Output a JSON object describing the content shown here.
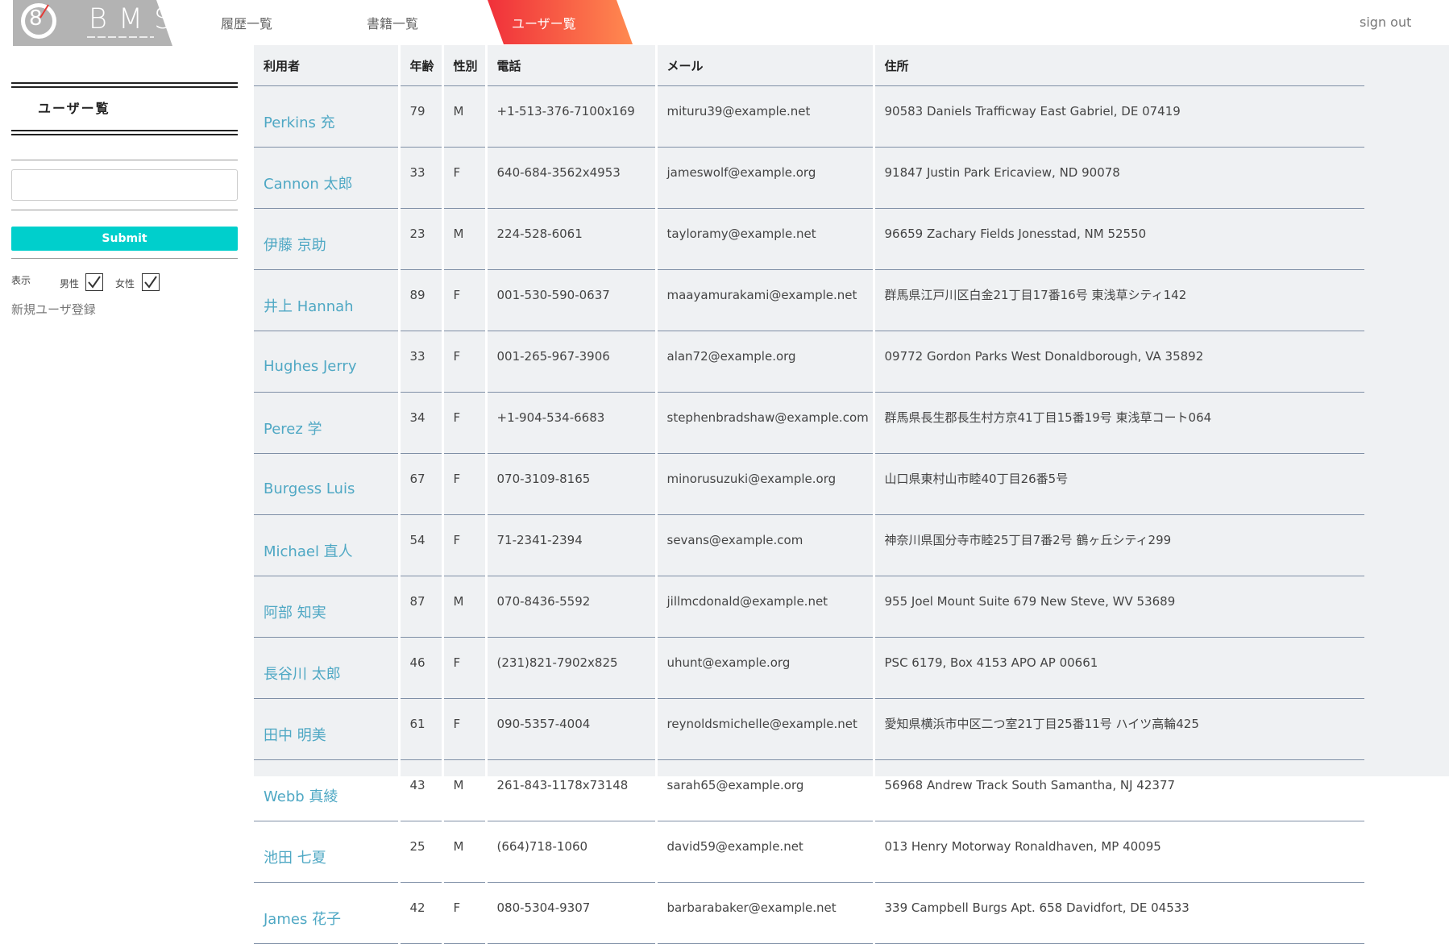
{
  "logo": {
    "text": "BMS",
    "digit": "8"
  },
  "nav": {
    "history": "履歴一覧",
    "books": "書籍一覧",
    "users": "ユーザー覧",
    "signout": "sign out"
  },
  "sidebar": {
    "title": "ユーザー覧",
    "search_value": "",
    "submit_label": "Submit",
    "display_label": "表示",
    "male_label": "男性",
    "female_label": "女性",
    "male_checked": true,
    "female_checked": true,
    "register_link": "新規ユーザ登録"
  },
  "colors": {
    "accent": "#00cfcc",
    "link": "#4fa8c4",
    "nav_active_start": "#f0303a",
    "nav_active_end": "#ff8a50",
    "panel_bg": "#eff1f3"
  },
  "table": {
    "headers": [
      "利用者",
      "年齢",
      "性別",
      "電話",
      "メール",
      "住所"
    ],
    "rows": [
      [
        "Perkins 充",
        "79",
        "M",
        "+1-513-376-7100x169",
        "mituru39@example.net",
        "90583 Daniels Trafficway East Gabriel, DE 07419"
      ],
      [
        "Cannon 太郎",
        "33",
        "F",
        "640-684-3562x4953",
        "jameswolf@example.org",
        "91847 Justin Park Ericaview, ND 90078"
      ],
      [
        "伊藤 京助",
        "23",
        "M",
        "224-528-6061",
        "tayloramy@example.net",
        "96659 Zachary Fields Jonesstad, NM 52550"
      ],
      [
        "井上 Hannah",
        "89",
        "F",
        "001-530-590-0637",
        "maayamurakami@example.net",
        "群馬県江戸川区白金21丁目17番16号 東浅草シティ142"
      ],
      [
        "Hughes Jerry",
        "33",
        "F",
        "001-265-967-3906",
        "alan72@example.org",
        "09772 Gordon Parks West Donaldborough, VA 35892"
      ],
      [
        "Perez 学",
        "34",
        "F",
        "+1-904-534-6683",
        "stephenbradshaw@example.com",
        "群馬県長生郡長生村方京41丁目15番19号 東浅草コート064"
      ],
      [
        "Burgess Luis",
        "67",
        "F",
        "070-3109-8165",
        "minorusuzuki@example.org",
        "山口県東村山市睦40丁目26番5号"
      ],
      [
        "Michael 直人",
        "54",
        "F",
        "71-2341-2394",
        "sevans@example.com",
        "神奈川県国分寺市睦25丁目7番2号 鶴ヶ丘シティ299"
      ],
      [
        "阿部 知実",
        "87",
        "M",
        "070-8436-5592",
        "jillmcdonald@example.net",
        "955 Joel Mount Suite 679 New Steve, WV 53689"
      ],
      [
        "長谷川 太郎",
        "46",
        "F",
        "(231)821-7902x825",
        "uhunt@example.org",
        "PSC 6179, Box 4153 APO AP 00661"
      ],
      [
        "田中 明美",
        "61",
        "F",
        "090-5357-4004",
        "reynoldsmichelle@example.net",
        "愛知県横浜市中区二つ室21丁目25番11号 ハイツ高輪425"
      ],
      [
        "Webb 真綾",
        "43",
        "M",
        "261-843-1178x73148",
        "sarah65@example.org",
        "56968 Andrew Track South Samantha, NJ 42377"
      ],
      [
        "池田 七夏",
        "25",
        "M",
        "(664)718-1060",
        "david59@example.net",
        "013 Henry Motorway Ronaldhaven, MP 40095"
      ],
      [
        "James 花子",
        "42",
        "F",
        "080-5304-9307",
        "barbarabaker@example.net",
        "339 Campbell Burgs Apt. 658 Davidfort, DE 04533"
      ]
    ]
  }
}
